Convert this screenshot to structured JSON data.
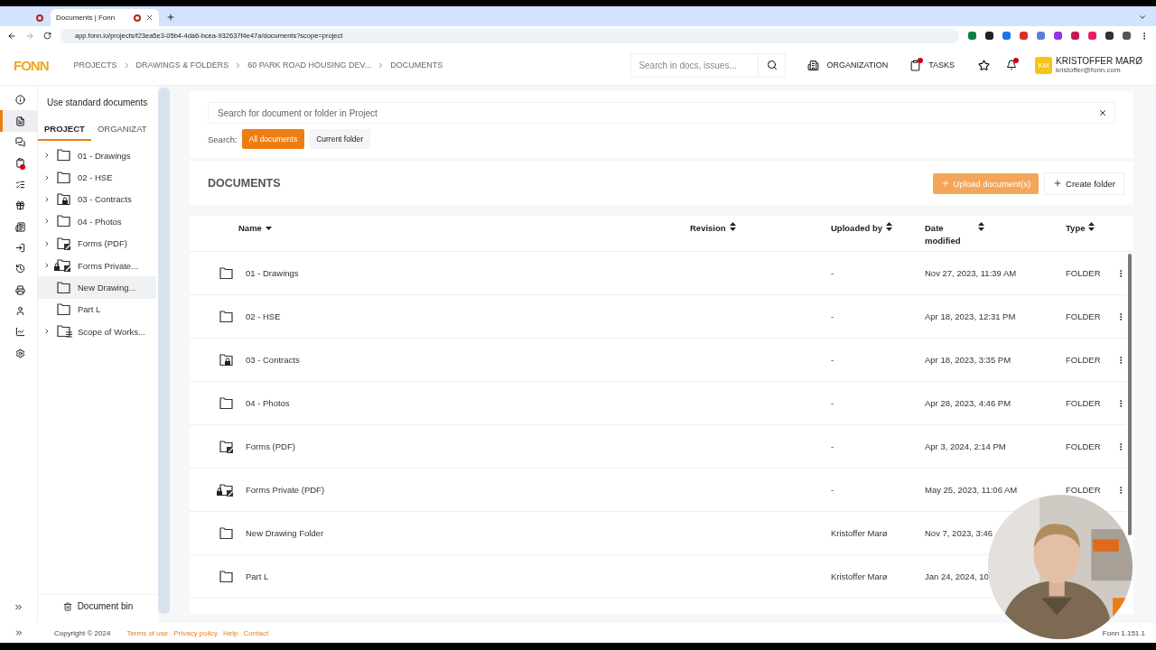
{
  "browser": {
    "tabs": [
      {
        "title": "Documents | Fonn",
        "selected": true
      }
    ],
    "url": "app.fonn.io/projects/f23ea5e3-05b4-4da6-bcea-932637f4e47a/documents?scope=project"
  },
  "header": {
    "logo": "FONN",
    "breadcrumbs": [
      "PROJECTS",
      "DRAWINGS & FOLDERS",
      "60 PARK ROAD HOUSING DEV...",
      "DOCUMENTS"
    ],
    "search": {
      "placeholder": "Search in docs, issues..."
    },
    "nav": [
      {
        "label": "ORGANIZATION",
        "kind": "building",
        "alert": false
      },
      {
        "label": "TASKS",
        "kind": "clipboard",
        "alert": true
      }
    ],
    "notifications_alert": true,
    "user": {
      "initials": "KM",
      "name": "KRISTOFFER MARØ",
      "email": "kristoffer@fonn.com"
    }
  },
  "rail": [
    {
      "kind": "info",
      "selected": false,
      "alert": false
    },
    {
      "kind": "documents",
      "selected": true,
      "alert": false
    },
    {
      "kind": "chat",
      "selected": false,
      "alert": false
    },
    {
      "kind": "clipboard",
      "selected": false,
      "alert": true
    },
    {
      "kind": "checklist",
      "selected": false,
      "alert": false
    },
    {
      "kind": "gift",
      "selected": false,
      "alert": false
    },
    {
      "kind": "news",
      "selected": false,
      "alert": false
    },
    {
      "kind": "login",
      "selected": false,
      "alert": false
    },
    {
      "kind": "history",
      "selected": false,
      "alert": false
    },
    {
      "kind": "print",
      "selected": false,
      "alert": false
    },
    {
      "kind": "user",
      "selected": false,
      "alert": false
    },
    {
      "kind": "chart",
      "selected": false,
      "alert": false
    },
    {
      "kind": "settings",
      "selected": false,
      "alert": false
    }
  ],
  "sidebar": {
    "standard_button": "Use standard documents",
    "tabs": [
      {
        "label": "PROJECT",
        "selected": true
      },
      {
        "label": "ORGANIZAT",
        "selected": false
      }
    ],
    "tree": [
      {
        "label": "01 - Drawings",
        "kind": "folder",
        "has_children": true,
        "selected": false
      },
      {
        "label": "02 - HSE",
        "kind": "folder",
        "has_children": true,
        "selected": false
      },
      {
        "label": "03 - Contracts",
        "kind": "locked",
        "has_children": true,
        "selected": false
      },
      {
        "label": "04 - Photos",
        "kind": "folder",
        "has_children": true,
        "selected": false
      },
      {
        "label": "Forms (PDF)",
        "kind": "form",
        "has_children": true,
        "selected": false
      },
      {
        "label": "Forms Private...",
        "kind": "locked_form",
        "has_children": true,
        "selected": false
      },
      {
        "label": "New Drawing...",
        "kind": "folder",
        "has_children": false,
        "selected": true
      },
      {
        "label": "Part L",
        "kind": "folder",
        "has_children": false,
        "selected": false
      },
      {
        "label": "Scope of Works...",
        "kind": "list",
        "has_children": true,
        "selected": false
      }
    ],
    "bin_button": "Document bin"
  },
  "main": {
    "search": {
      "placeholder": "Search for document or folder in Project"
    },
    "scope_label": "Search:",
    "scopes": [
      {
        "label": "All documents",
        "selected": true
      },
      {
        "label": "Current folder",
        "selected": false
      }
    ],
    "title": "DOCUMENTS",
    "upload_button": "Upload document(s)",
    "create_button": "Create folder",
    "table": {
      "columns": [
        {
          "label": "Name",
          "sorted": true
        },
        {
          "label": "Revision",
          "sorted": false
        },
        {
          "label": "Uploaded by",
          "sorted": false
        },
        {
          "label": "Date modified",
          "sorted": false
        },
        {
          "label": "Type",
          "sorted": false
        }
      ],
      "rows": [
        {
          "kind": "folder",
          "name": "01 - Drawings",
          "uploaded_by": "-",
          "date_modified": "Nov 27, 2023, 11:39 AM",
          "type": "FOLDER"
        },
        {
          "kind": "folder",
          "name": "02 - HSE",
          "uploaded_by": "-",
          "date_modified": "Apr 18, 2023, 12:31 PM",
          "type": "FOLDER"
        },
        {
          "kind": "locked",
          "name": "03 - Contracts",
          "uploaded_by": "-",
          "date_modified": "Apr 18, 2023, 3:35 PM",
          "type": "FOLDER"
        },
        {
          "kind": "folder",
          "name": "04 - Photos",
          "uploaded_by": "-",
          "date_modified": "Apr 28, 2023, 4:46 PM",
          "type": "FOLDER"
        },
        {
          "kind": "form",
          "name": "Forms (PDF)",
          "uploaded_by": "-",
          "date_modified": "Apr 3, 2024, 2:14 PM",
          "type": "FOLDER"
        },
        {
          "kind": "locked_form",
          "name": "Forms Private (PDF)",
          "uploaded_by": "-",
          "date_modified": "May 25, 2023, 11:06 AM",
          "type": "FOLDER"
        },
        {
          "kind": "folder",
          "name": "New Drawing Folder",
          "uploaded_by": "Kristoffer Marø",
          "date_modified": "Nov 7, 2023, 3:46"
        },
        {
          "kind": "folder",
          "name": "Part L",
          "uploaded_by": "Kristoffer Marø",
          "date_modified": "Jan 24, 2024, 10"
        }
      ]
    }
  },
  "footer": {
    "copyright": "Copyright © 2024",
    "links": [
      "Terms of use",
      "Privacy policy",
      "Help",
      "Contact"
    ],
    "version": "Fonn 1.151.1"
  }
}
